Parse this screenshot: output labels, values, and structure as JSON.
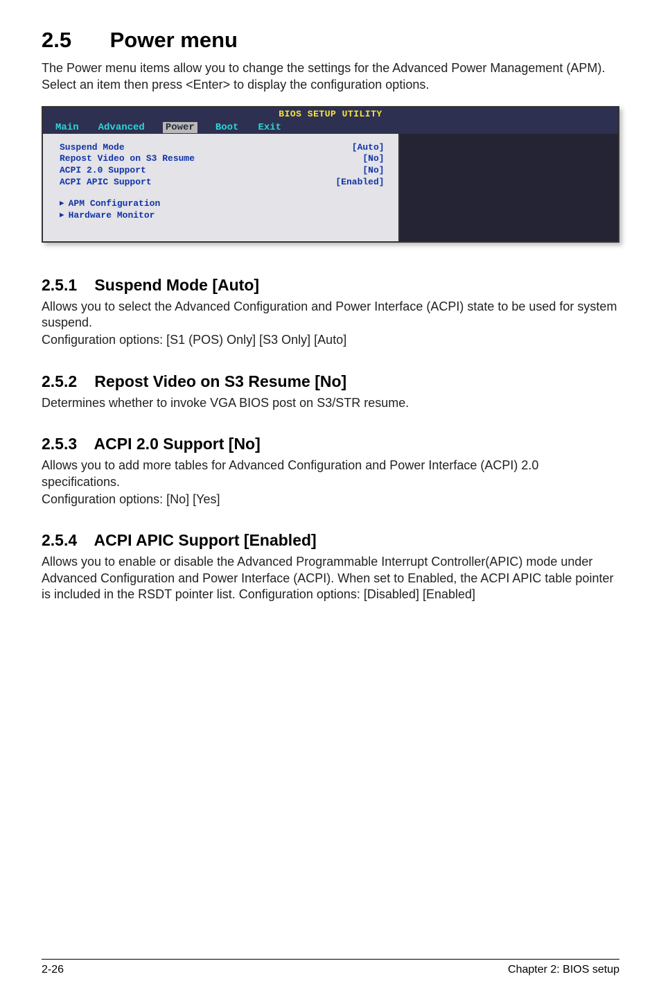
{
  "heading": {
    "number": "2.5",
    "title": "Power menu"
  },
  "intro": "The Power menu items allow you to change the settings for the Advanced Power Management (APM). Select an item then press <Enter> to display the configuration options.",
  "bios": {
    "title": "BIOS SETUP UTILITY",
    "tabs": [
      "Main",
      "Advanced",
      "Power",
      "Boot",
      "Exit"
    ],
    "active_tab": "Power",
    "rows": [
      {
        "label": "Suspend Mode",
        "value": "[Auto]"
      },
      {
        "label": "Repost Video on S3 Resume",
        "value": "[No]"
      },
      {
        "label": "ACPI 2.0 Support",
        "value": "[No]"
      },
      {
        "label": "ACPI APIC Support",
        "value": "[Enabled]"
      }
    ],
    "submenus": [
      "APM Configuration",
      "Hardware Monitor"
    ]
  },
  "sections": [
    {
      "number": "2.5.1",
      "title": "Suspend Mode [Auto]",
      "paragraphs": [
        "Allows you to select the Advanced Configuration and Power Interface (ACPI) state to be used for system suspend.",
        "Configuration options: [S1 (POS) Only] [S3 Only] [Auto]"
      ]
    },
    {
      "number": "2.5.2",
      "title": "Repost Video on S3 Resume [No]",
      "paragraphs": [
        "Determines whether to invoke VGA BIOS post on S3/STR resume."
      ]
    },
    {
      "number": "2.5.3",
      "title": "ACPI 2.0 Support [No]",
      "paragraphs": [
        "Allows you to add more tables for Advanced Configuration and Power Interface (ACPI) 2.0 specifications.",
        "Configuration options: [No] [Yes]"
      ]
    },
    {
      "number": "2.5.4",
      "title": "ACPI APIC Support [Enabled]",
      "paragraphs": [
        "Allows you to enable or disable the Advanced Programmable Interrupt Controller(APIC) mode under Advanced Configuration and Power Interface (ACPI). When set to Enabled, the ACPI APIC table pointer is included in the RSDT pointer list. Configuration options: [Disabled] [Enabled]"
      ]
    }
  ],
  "footer": {
    "left": "2-26",
    "right": "Chapter 2: BIOS setup"
  }
}
